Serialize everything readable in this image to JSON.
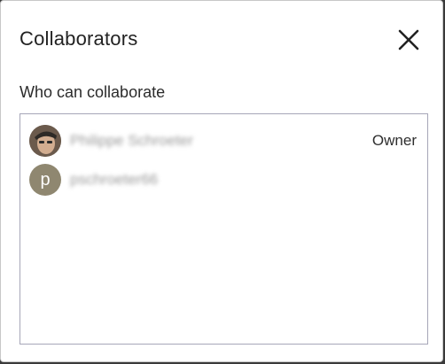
{
  "dialog": {
    "title": "Collaborators",
    "subtitle": "Who can collaborate"
  },
  "collaborators": [
    {
      "name": "Philippe Schroeter",
      "role": "Owner",
      "avatar": "photo"
    },
    {
      "name": "pschroeter66",
      "role": "",
      "avatar": "letter",
      "initial": "p"
    }
  ],
  "icons": {
    "close": "close-icon"
  },
  "colors": {
    "avatar_letter_bg": "#8f8770",
    "list_border": "#a6a6b8"
  }
}
